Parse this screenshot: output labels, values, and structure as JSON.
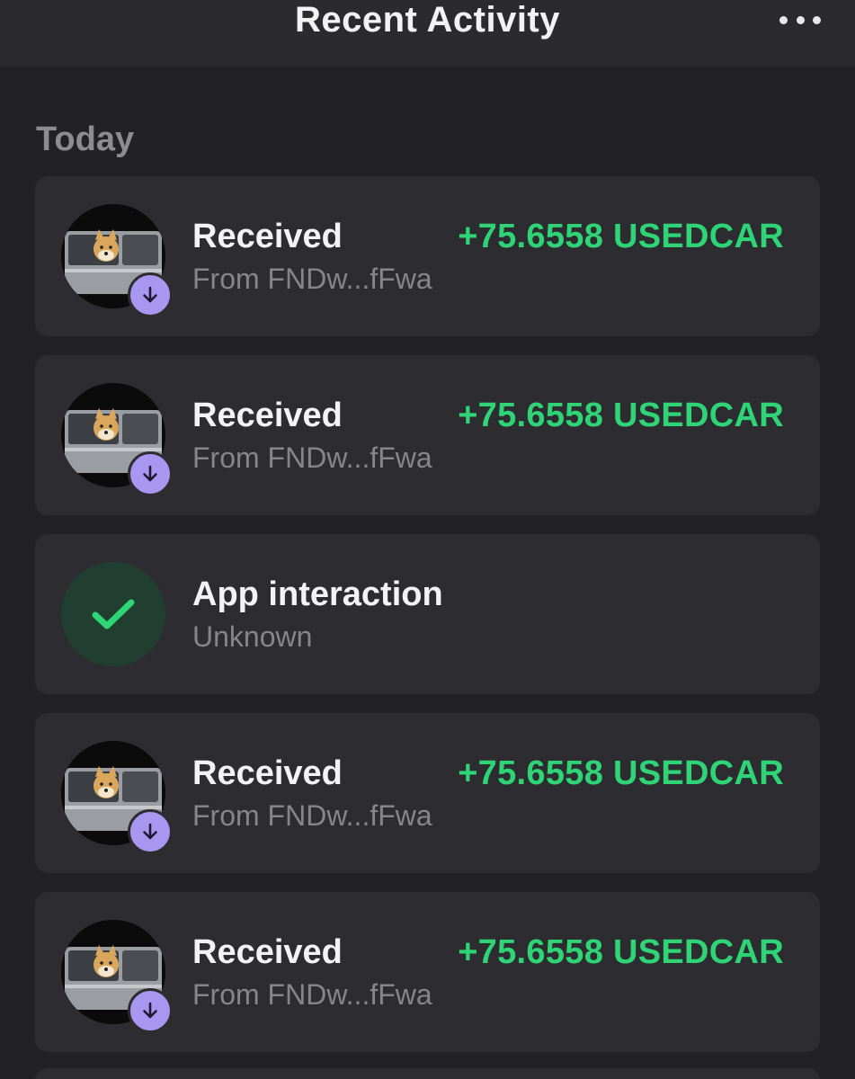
{
  "header": {
    "title": "Recent Activity",
    "more_icon": "more-horizontal-icon"
  },
  "section": {
    "label": "Today"
  },
  "colors": {
    "background": "#222224",
    "card": "#2d2d31",
    "amount_positive": "#2fd476",
    "badge": "#a897f0",
    "success": "#2fd476"
  },
  "activities": [
    {
      "type": "received",
      "title": "Received",
      "subtitle": "From FNDw...fFwa",
      "amount": "+75.6558 USEDCAR",
      "avatar_icon": "token-avatar",
      "badge_icon": "arrow-down-icon"
    },
    {
      "type": "received",
      "title": "Received",
      "subtitle": "From FNDw...fFwa",
      "amount": "+75.6558 USEDCAR",
      "avatar_icon": "token-avatar",
      "badge_icon": "arrow-down-icon"
    },
    {
      "type": "app",
      "title": "App interaction",
      "subtitle": "Unknown",
      "avatar_icon": "checkmark-icon"
    },
    {
      "type": "received",
      "title": "Received",
      "subtitle": "From FNDw...fFwa",
      "amount": "+75.6558 USEDCAR",
      "avatar_icon": "token-avatar",
      "badge_icon": "arrow-down-icon"
    },
    {
      "type": "received",
      "title": "Received",
      "subtitle": "From FNDw...fFwa",
      "amount": "+75.6558 USEDCAR",
      "avatar_icon": "token-avatar",
      "badge_icon": "arrow-down-icon"
    }
  ]
}
